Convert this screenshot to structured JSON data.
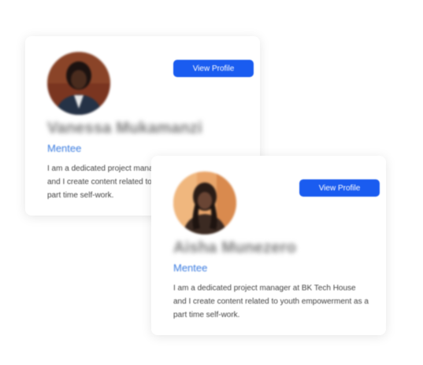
{
  "colors": {
    "accent": "#1a5cf0",
    "role_text": "#3b7ce0"
  },
  "profiles": [
    {
      "name": "Vanessa Mukamanzi",
      "role": "Mentee",
      "bio": "I am a dedicated project manager at BK Tech House and I create content related to youth empowerment as a part time self-work.",
      "button_label": "View Profile",
      "avatar_icon": "person-avatar"
    },
    {
      "name": "Aisha Munezero",
      "role": "Mentee",
      "bio": "I am a dedicated project manager at BK Tech House and I create content related to youth empowerment as a part time self-work.",
      "button_label": "View Profile",
      "avatar_icon": "person-avatar"
    }
  ]
}
